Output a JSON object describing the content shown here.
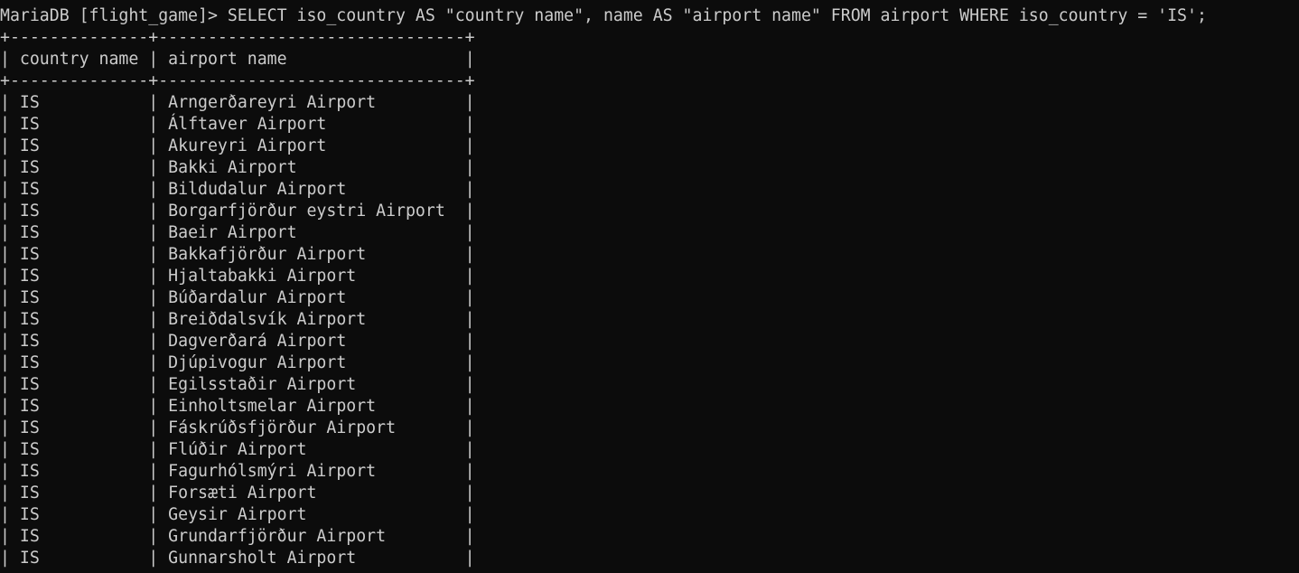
{
  "prompt": "MariaDB [flight_game]>",
  "command": "SELECT iso_country AS \"country name\", name AS \"airport name\" FROM airport WHERE iso_country = 'IS';",
  "colors": {
    "background": "#0c0c0c",
    "foreground": "#cccccc"
  },
  "table": {
    "columns": [
      "country name",
      "airport name"
    ],
    "rows": [
      [
        "IS",
        "Arngerðareyri Airport"
      ],
      [
        "IS",
        "Álftaver Airport"
      ],
      [
        "IS",
        "Akureyri Airport"
      ],
      [
        "IS",
        "Bakki Airport"
      ],
      [
        "IS",
        "Bildudalur Airport"
      ],
      [
        "IS",
        "Borgarfjörður eystri Airport"
      ],
      [
        "IS",
        "Baeir Airport"
      ],
      [
        "IS",
        "Bakkafjörður Airport"
      ],
      [
        "IS",
        "Hjaltabakki Airport"
      ],
      [
        "IS",
        "Búðardalur Airport"
      ],
      [
        "IS",
        "Breiðdalsvík Airport"
      ],
      [
        "IS",
        "Dagverðará Airport"
      ],
      [
        "IS",
        "Djúpivogur Airport"
      ],
      [
        "IS",
        "Egilsstaðir Airport"
      ],
      [
        "IS",
        "Einholtsmelar Airport"
      ],
      [
        "IS",
        "Fáskrúðsfjörður Airport"
      ],
      [
        "IS",
        "Flúðir Airport"
      ],
      [
        "IS",
        "Fagurhólsmýri Airport"
      ],
      [
        "IS",
        "Forsæti Airport"
      ],
      [
        "IS",
        "Geysir Airport"
      ],
      [
        "IS",
        "Grundarfjörður Airport"
      ],
      [
        "IS",
        "Gunnarsholt Airport"
      ]
    ]
  }
}
